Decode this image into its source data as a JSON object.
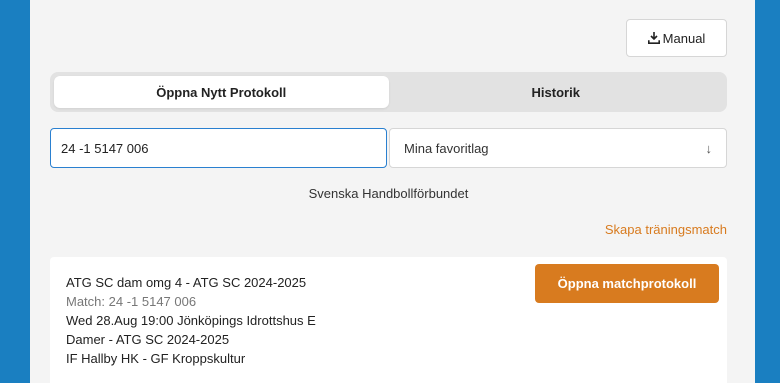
{
  "header": {
    "manual_label": "Manual"
  },
  "tabs": [
    {
      "label": "Öppna Nytt Protokoll",
      "active": true
    },
    {
      "label": "Historik",
      "active": false
    }
  ],
  "search": {
    "value": "24 -1 5147 006"
  },
  "favorites": {
    "label": "Mina favoritlag",
    "arrow": "↓"
  },
  "federation": "Svenska Handbollförbundet",
  "training_link": "Skapa träningsmatch",
  "match": {
    "title": "ATG SC dam omg 4 - ATG SC 2024-2025",
    "match_id": "Match: 24 -1 5147 006",
    "datetime_venue": "Wed 28.Aug 19:00 Jönköpings Idrottshus E",
    "league": "Damer - ATG SC 2024-2025",
    "teams": "IF Hallby HK - GF Kroppskultur",
    "open_label": "Öppna matchprotokoll"
  },
  "colors": {
    "background": "#1a7fc1",
    "accent": "#d87b1f",
    "input_focus": "#2a80d0"
  },
  "icons": {
    "manual": "download-icon",
    "favorites": "arrow-down-icon"
  }
}
